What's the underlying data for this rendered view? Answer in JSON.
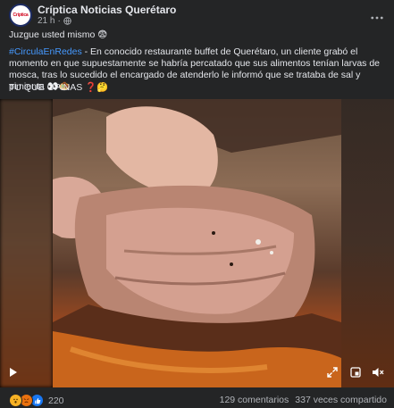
{
  "post": {
    "page_name": "Críptica Noticias Querétaro",
    "avatar_text": "Críptica",
    "time": "21 h",
    "separator": "·",
    "line1": "Juzgue usted mismo 😨",
    "hashtag": "#CirculaEnRedes",
    "body": " - En conocido restaurante buffet de Querétaro, un cliente grabó el momento en que supuestamente se habría percatado que sus alimentos tenían larvas de mosca, tras lo sucedido el encargado de atenderlo le informó que se trataba de sal y pimienta 👀🧆",
    "question": "TU QUE OPINAS ❓🤔"
  },
  "footer": {
    "reaction_count": "220",
    "comments": "129 comentarios",
    "shares": "337 veces compartido"
  },
  "icons": {
    "globe": "globe-icon",
    "more": "more-options-icon",
    "play": "play-icon",
    "expand": "expand-icon",
    "pip": "picture-in-picture-icon",
    "volume": "volume-icon"
  },
  "colors": {
    "background": "#242526",
    "text": "#e4e6eb",
    "secondary_text": "#b0b3b8",
    "hashtag": "#4599ff",
    "like": "#1877f2"
  }
}
